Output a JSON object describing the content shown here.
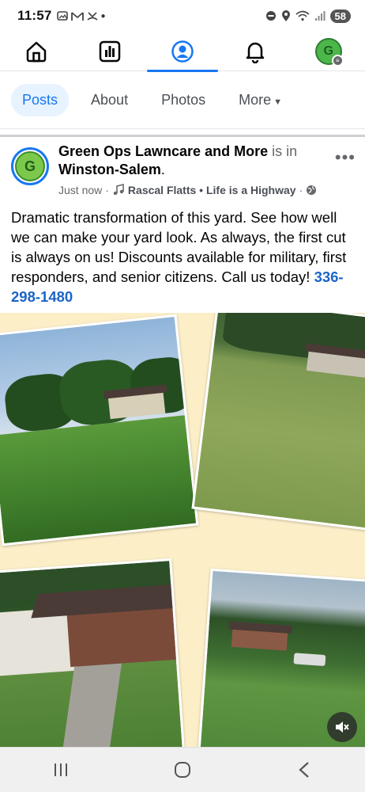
{
  "status": {
    "time": "11:57",
    "battery": "58",
    "network": "6E"
  },
  "nav": {
    "items": [
      {
        "name": "home",
        "icon": "home-icon"
      },
      {
        "name": "pages",
        "icon": "chart-icon"
      },
      {
        "name": "profile",
        "icon": "profile-icon"
      },
      {
        "name": "notifications",
        "icon": "bell-icon"
      },
      {
        "name": "account",
        "icon": "avatar-icon"
      }
    ],
    "avatar_letter": "G"
  },
  "tabs": [
    {
      "label": "Posts",
      "active": true
    },
    {
      "label": "About",
      "active": false
    },
    {
      "label": "Photos",
      "active": false
    },
    {
      "label": "More",
      "active": false
    }
  ],
  "post": {
    "avatar_letter": "G",
    "author": "Green Ops Lawncare and More",
    "is_in": "is in",
    "location": "Winston-Salem",
    "period": ".",
    "time": "Just now",
    "music": "Rascal Flatts • Life is a Highway",
    "body": "Dramatic transformation of this yard. See how well we can make your yard look. As always, the first cut is always on us! Discounts available for military, first responders, and senior citizens. Call us today! ",
    "phone": "336-298-1480"
  },
  "colors": {
    "accent": "#1877f2",
    "link": "#1b64c9",
    "collage_bg": "#fcefc8"
  }
}
